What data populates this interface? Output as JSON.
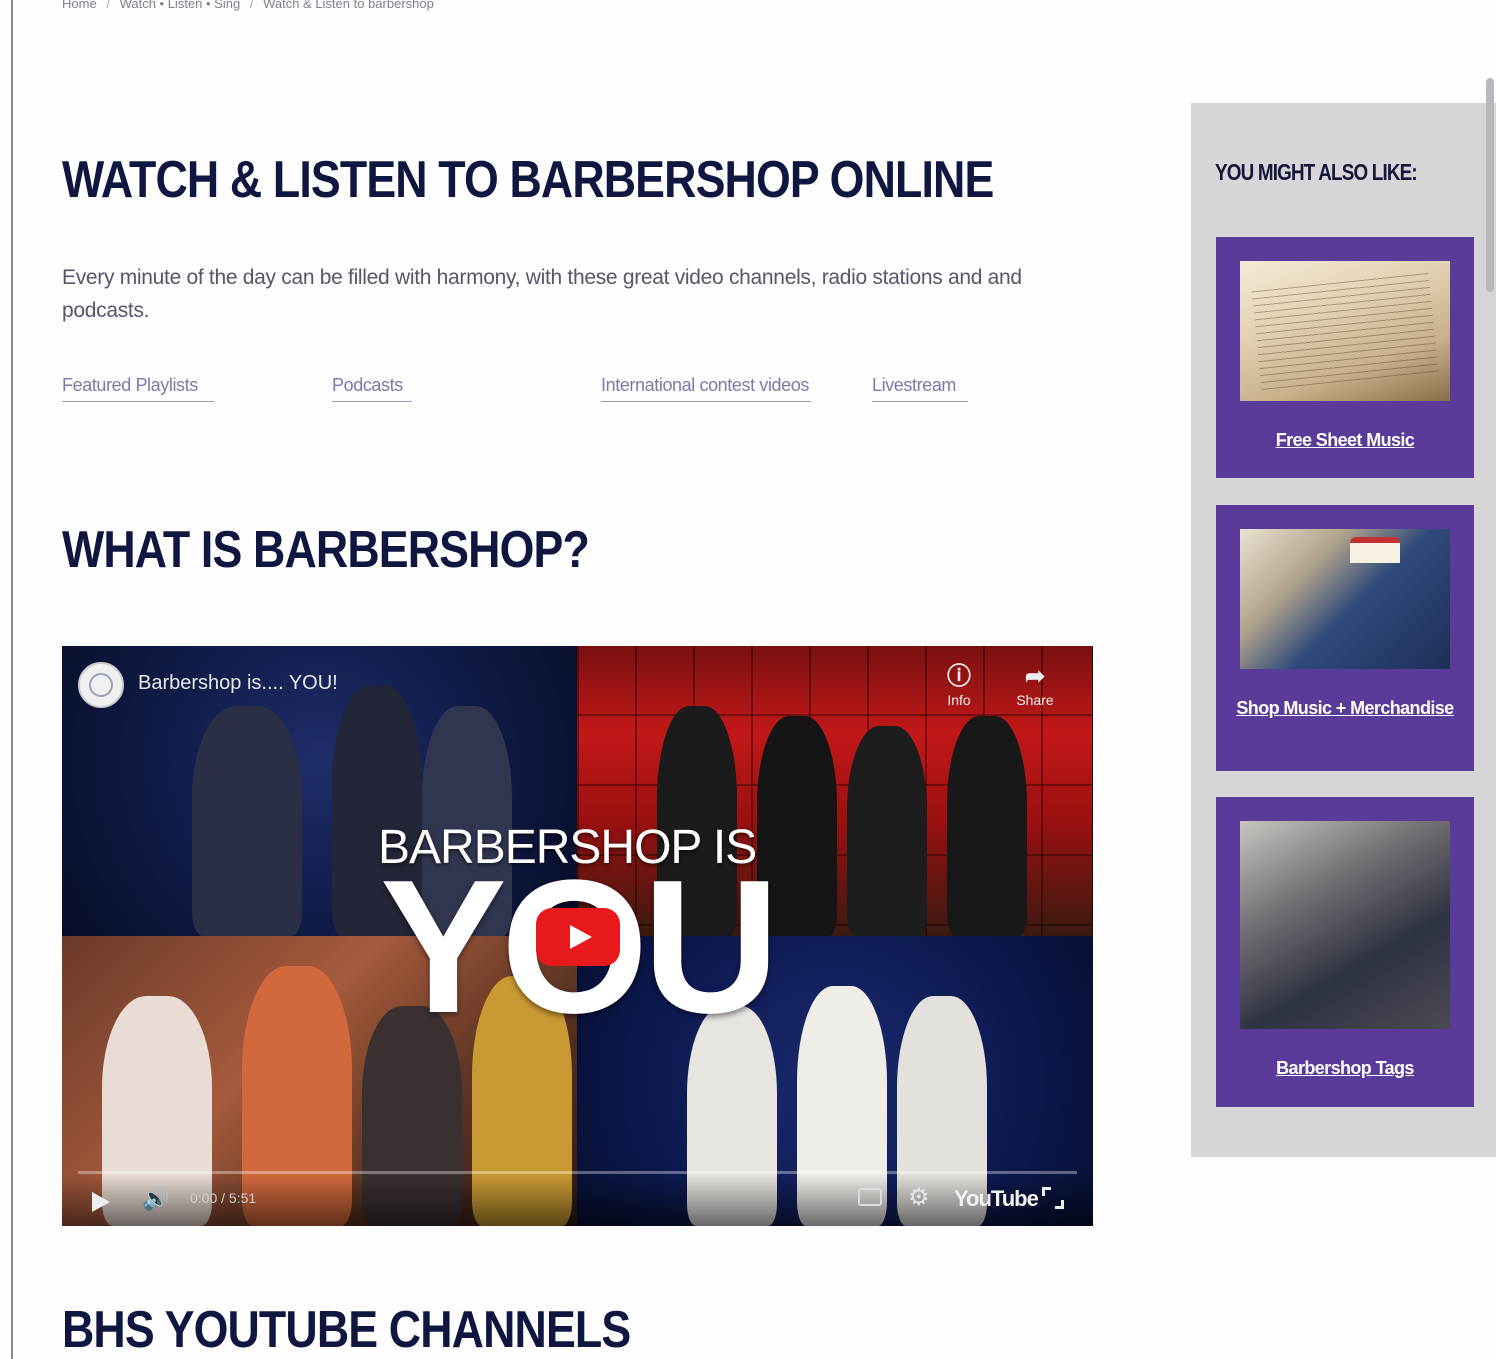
{
  "breadcrumb": {
    "items": [
      "Home",
      "Watch • Listen • Sing",
      "Watch & Listen to barbershop"
    ],
    "separator": "/"
  },
  "main": {
    "title": "WATCH & LISTEN TO BARBERSHOP ONLINE",
    "intro": "Every minute of the day can be filled with harmony, with these great video channels, radio stations and and podcasts.",
    "tabs": [
      {
        "label": "Featured Playlists"
      },
      {
        "label": "Podcasts"
      },
      {
        "label": "International contest videos"
      },
      {
        "label": "Livestream"
      }
    ],
    "section1_title": "WHAT IS BARBERSHOP?",
    "section2_title": "BHS YOUTUBE CHANNELS"
  },
  "video": {
    "title": "Barbershop is.... YOU!",
    "info_label": "Info",
    "share_label": "Share",
    "overlay_line1": "BARBERSHOP IS",
    "overlay_line2": "YOU",
    "time": "0:00 / 5:51",
    "brand": "YouTube",
    "icons": [
      "info-icon",
      "share-icon",
      "play-icon",
      "volume-icon",
      "captions-icon",
      "settings-icon",
      "fullscreen-icon"
    ]
  },
  "sidebar": {
    "title": "YOU MIGHT ALSO LIKE:",
    "cards": [
      {
        "label": "Free Sheet Music"
      },
      {
        "label": "Shop Music + Merchandise"
      },
      {
        "label": "Barbershop Tags"
      }
    ]
  },
  "colors": {
    "heading": "#0f1740",
    "card_purple": "#5b3b99",
    "sidebar_bg": "#d6d6d8",
    "link": "#7b7aa8",
    "play_red": "#e8191c"
  }
}
